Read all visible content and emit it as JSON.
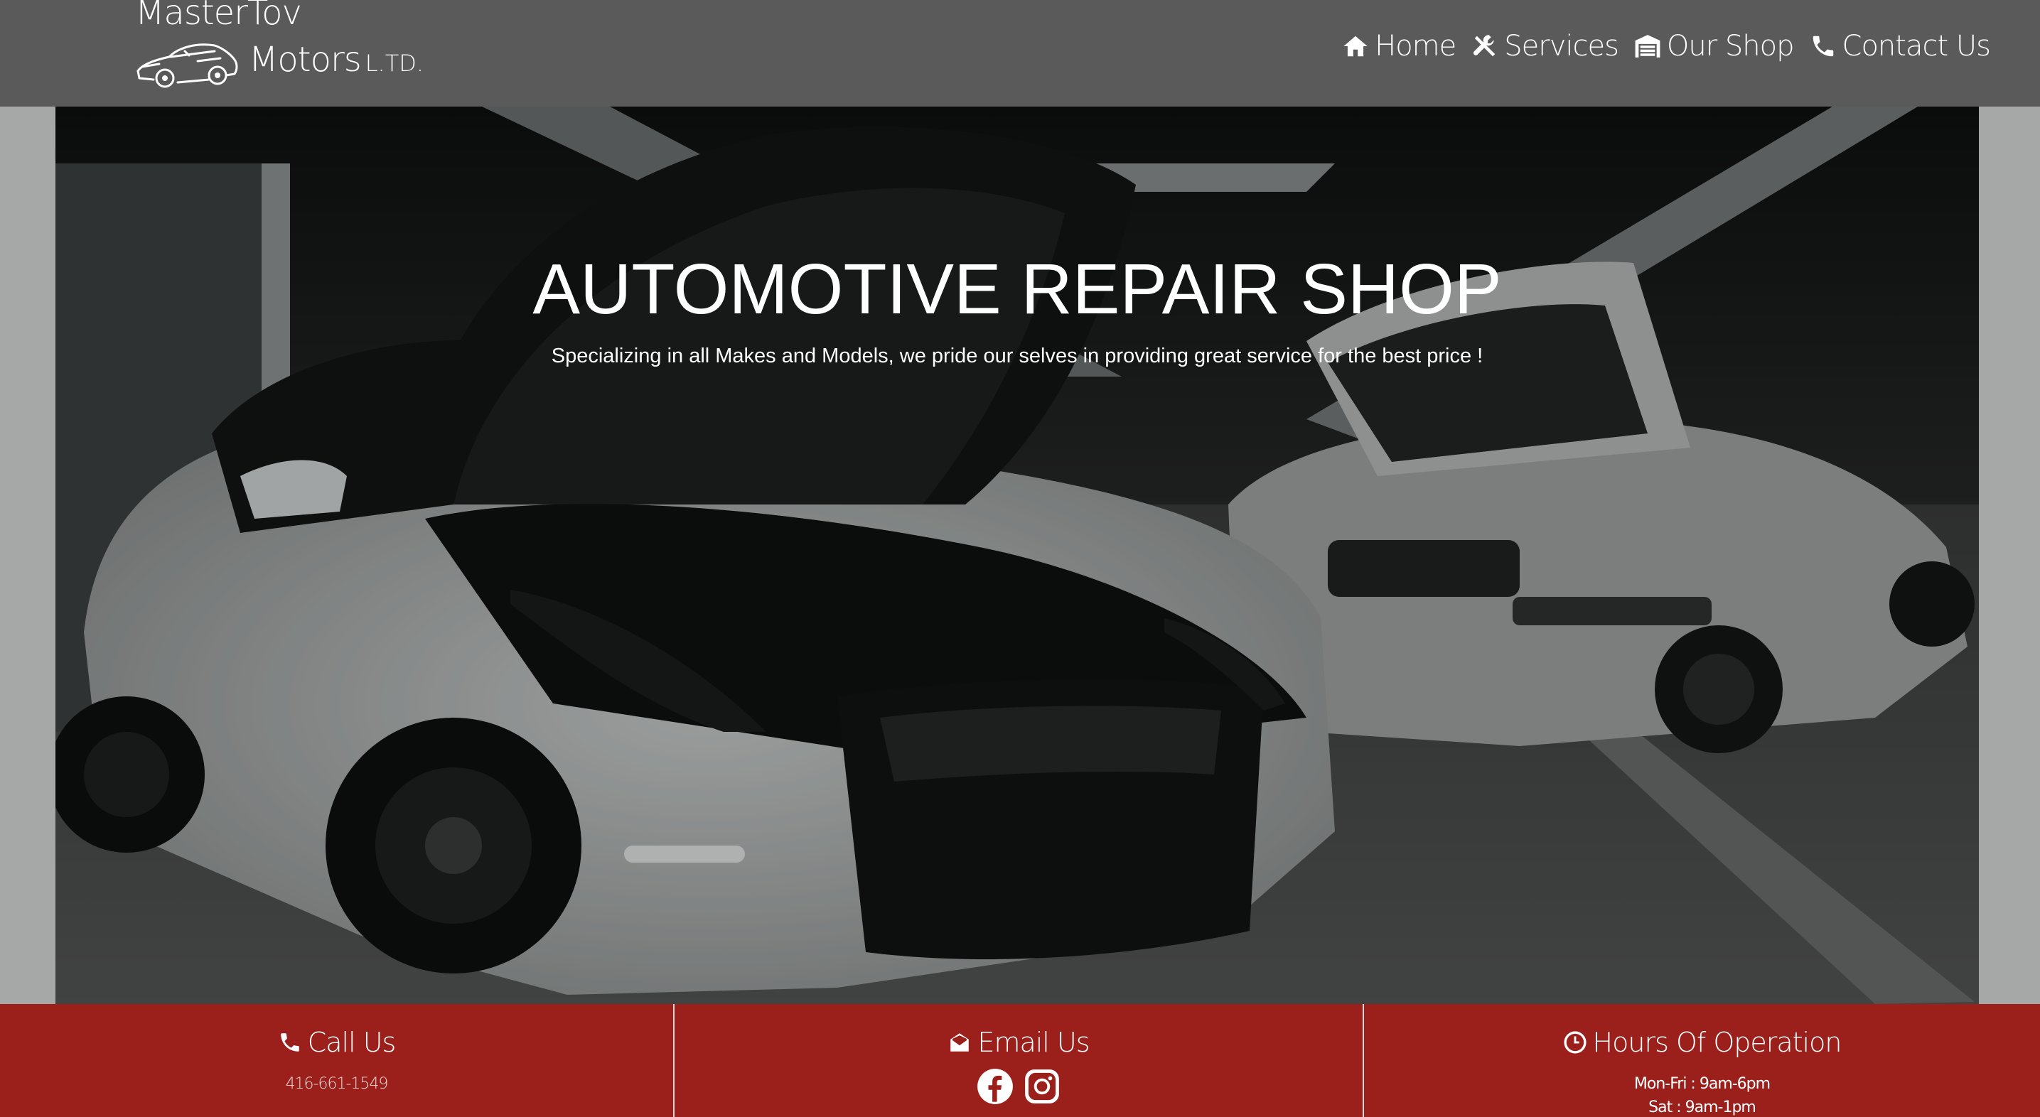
{
  "brand": {
    "line1": "MasterTov",
    "line2": "Motors",
    "suffix": "L.TD."
  },
  "nav": {
    "items": [
      {
        "label": "Home",
        "icon": "home-icon"
      },
      {
        "label": "Services",
        "icon": "tools-icon"
      },
      {
        "label": "Our Shop",
        "icon": "garage-icon"
      },
      {
        "label": "Contact Us",
        "icon": "phone-icon"
      }
    ]
  },
  "hero": {
    "title": "AUTOMOTIVE REPAIR SHOP",
    "subtitle": "Specializing in all Makes and Models, we pride our selves in providing great service for the best price !"
  },
  "info": {
    "call": {
      "heading": "Call Us",
      "phone": "416-661-1549",
      "icon": "phone-icon"
    },
    "email": {
      "heading": "Email Us",
      "icon": "envelope-icon",
      "social": [
        "facebook-icon",
        "instagram-icon"
      ]
    },
    "hours": {
      "heading": "Hours Of Operation",
      "icon": "clock-icon",
      "line1": "Mon-Fri : 9am-6pm",
      "line2": "Sat : 9am-1pm"
    }
  },
  "colors": {
    "header_bg": "#5a5a5a",
    "footer_bg": "#9b1f1b",
    "page_bg": "#a5a8a6"
  }
}
